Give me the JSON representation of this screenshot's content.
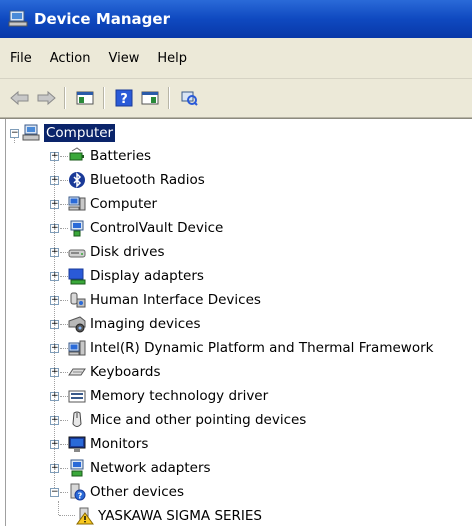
{
  "window": {
    "title": "Device Manager"
  },
  "menu": {
    "items": [
      "File",
      "Action",
      "View",
      "Help"
    ]
  },
  "tree": {
    "root": "Computer",
    "categories": [
      {
        "label": "Batteries",
        "icon": "battery-icon"
      },
      {
        "label": "Bluetooth Radios",
        "icon": "bluetooth-icon"
      },
      {
        "label": "Computer",
        "icon": "computer-icon"
      },
      {
        "label": "ControlVault Device",
        "icon": "controlvault-icon"
      },
      {
        "label": "Disk drives",
        "icon": "disk-drive-icon"
      },
      {
        "label": "Display adapters",
        "icon": "display-adapter-icon"
      },
      {
        "label": "Human Interface Devices",
        "icon": "hid-icon"
      },
      {
        "label": "Imaging devices",
        "icon": "camera-icon"
      },
      {
        "label": "Intel(R) Dynamic Platform and Thermal Framework",
        "icon": "intel-icon"
      },
      {
        "label": "Keyboards",
        "icon": "keyboard-icon"
      },
      {
        "label": "Memory technology driver",
        "icon": "memory-icon"
      },
      {
        "label": "Mice and other pointing devices",
        "icon": "mouse-icon"
      },
      {
        "label": "Monitors",
        "icon": "monitor-icon"
      },
      {
        "label": "Network adapters",
        "icon": "network-icon"
      },
      {
        "label": "Other devices",
        "icon": "unknown-device-icon"
      }
    ],
    "child": {
      "label": "YASKAWA SIGMA SERIES",
      "icon": "warning-device-icon"
    }
  }
}
